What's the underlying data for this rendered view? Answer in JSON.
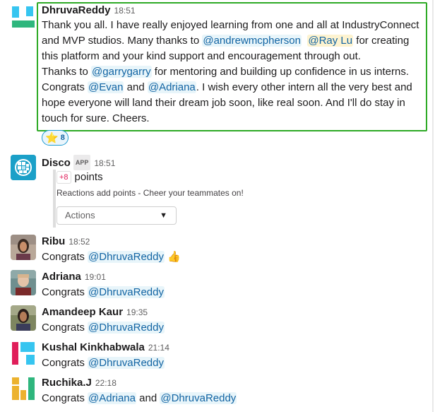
{
  "messages": [
    {
      "author": "DhruvaReddy",
      "time": "18:51",
      "text": {
        "p1": "Thank you all. I have really enjoyed learning from one and all at IndustryConnect and MVP studios. Many thanks to",
        "m1": "@andrewmcpherson",
        "m2": "@Ray Lu",
        "p2": "for creating this platform and your kind support and encouragement through out.",
        "p3": "Thanks to",
        "m3": "@garrygarry",
        "p4": "for mentoring and building up confidence in us interns.",
        "p5": "Congrats",
        "m4": "@Evan",
        "p6": "and",
        "m5": "@Adriana",
        "p7": ". I wish every other intern all the very best and hope everyone will land their dream job soon, like real soon. And I'll do stay in touch for sure. Cheers."
      },
      "reaction": {
        "icon": "star-icon",
        "emoji": "⭐",
        "count": "8"
      }
    },
    {
      "author": "Disco",
      "badge": "APP",
      "time": "18:51",
      "points_badge": "+8",
      "points_label": "points",
      "subtext": "Reactions add points - Cheer your teammates on!",
      "actions_label": "Actions"
    },
    {
      "author": "Ribu",
      "time": "18:52",
      "prefix": "Congrats",
      "mention": "@DhruvaReddy",
      "emoji": "👍"
    },
    {
      "author": "Adriana",
      "time": "19:01",
      "prefix": "Congrats",
      "mention": "@DhruvaReddy"
    },
    {
      "author": "Amandeep Kaur",
      "time": "19:35",
      "prefix": "Congrats",
      "mention": "@DhruvaReddy"
    },
    {
      "author": "Kushal Kinkhabwala",
      "time": "21:14",
      "prefix": "Congrats",
      "mention": "@DhruvaReddy"
    },
    {
      "author": "Ruchika.J",
      "time": "22:18",
      "prefix": "Congrats",
      "mention": "@Adriana",
      "middle": "and",
      "mention2": "@DhruvaReddy"
    }
  ],
  "colors": {
    "highlight_border": "#2eaa26",
    "mention_text": "#1264a3",
    "mention_bg": "#e8f5fa"
  }
}
